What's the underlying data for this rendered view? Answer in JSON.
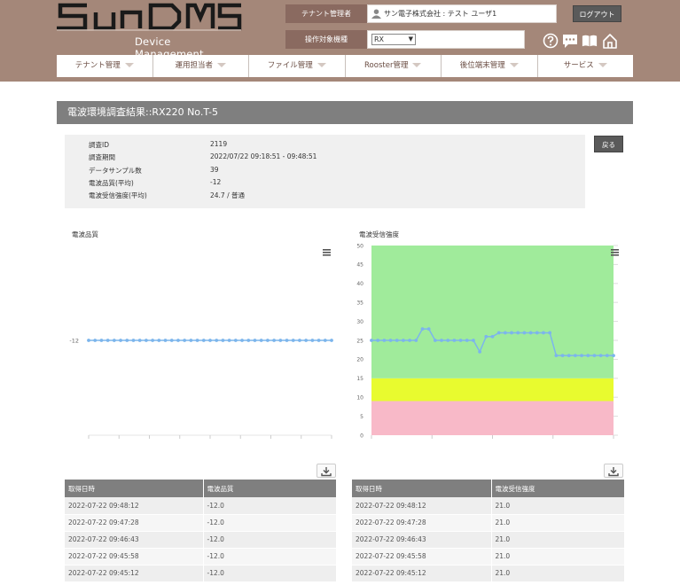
{
  "header": {
    "logo_text": "SunDMS",
    "logo_sub": "Device Management Service",
    "tenant_label": "テナント管理者",
    "tenant_value": "サン電子株式会社 : テスト ユーザ1",
    "model_label": "操作対象機種",
    "model_value": "RX",
    "logout_label": "ログアウト",
    "icons": [
      "help-icon",
      "chat-icon",
      "manual-icon",
      "home-icon"
    ]
  },
  "nav": {
    "items": [
      {
        "label": "テナント管理"
      },
      {
        "label": "運用担当者"
      },
      {
        "label": "ファイル管理"
      },
      {
        "label": "Rooster管理"
      },
      {
        "label": "後位端末管理"
      },
      {
        "label": "サービス"
      }
    ]
  },
  "page": {
    "title": "電波環境調査結果::RX220 No.T-5",
    "back_label": "戻る"
  },
  "info": {
    "rows": [
      {
        "key": "調査ID",
        "value": "2119"
      },
      {
        "key": "調査期間",
        "value": "2022/07/22 09:18:51 - 09:48:51"
      },
      {
        "key": "データサンプル数",
        "value": "39"
      },
      {
        "key": "電波品質(平均)",
        "value": "-12"
      },
      {
        "key": "電波受信強度(平均)",
        "value": "24.7 / 普通"
      }
    ]
  },
  "chart_data": [
    {
      "type": "line",
      "title": "電波品質",
      "y_ticks": [
        "-12"
      ],
      "series": [
        {
          "values": [
            -12,
            -12,
            -12,
            -12,
            -12,
            -12,
            -12,
            -12,
            -12,
            -12,
            -12,
            -12,
            -12,
            -12,
            -12,
            -12,
            -12,
            -12,
            -12,
            -12,
            -12,
            -12,
            -12,
            -12,
            -12,
            -12,
            -12,
            -12,
            -12,
            -12,
            -12,
            -12,
            -12,
            -12,
            -12,
            -12,
            -12,
            -12,
            -12
          ]
        }
      ],
      "line_color": "#7cb5ec"
    },
    {
      "type": "line",
      "title": "電波受信強度",
      "ylim": [
        0,
        50
      ],
      "y_ticks": [
        "0",
        "5",
        "10",
        "15",
        "20",
        "25",
        "30",
        "35",
        "40",
        "45",
        "50"
      ],
      "bands": [
        {
          "from": 0,
          "to": 9,
          "color": "#f8b9c8"
        },
        {
          "from": 9,
          "to": 15,
          "color": "#e8fb2f"
        },
        {
          "from": 15,
          "to": 50,
          "color": "#a0eb9b"
        }
      ],
      "series": [
        {
          "values": [
            25,
            25,
            25,
            25,
            25,
            25,
            25,
            25,
            28,
            28,
            25,
            25,
            25,
            25,
            25,
            25,
            25,
            22,
            26,
            26,
            27,
            27,
            27,
            27,
            27,
            27,
            27,
            27,
            27,
            21,
            21,
            21,
            21,
            21,
            21,
            21,
            21,
            21,
            21
          ]
        }
      ],
      "line_color": "#7cb5ec"
    }
  ],
  "tables": {
    "quality": {
      "headers": [
        "取得日時",
        "電波品質"
      ],
      "rows": [
        [
          "2022-07-22 09:48:12",
          "-12.0"
        ],
        [
          "2022-07-22 09:47:28",
          "-12.0"
        ],
        [
          "2022-07-22 09:46:43",
          "-12.0"
        ],
        [
          "2022-07-22 09:45:58",
          "-12.0"
        ],
        [
          "2022-07-22 09:45:12",
          "-12.0"
        ]
      ]
    },
    "strength": {
      "headers": [
        "取得日時",
        "電波受信強度"
      ],
      "rows": [
        [
          "2022-07-22 09:48:12",
          "21.0"
        ],
        [
          "2022-07-22 09:47:28",
          "21.0"
        ],
        [
          "2022-07-22 09:46:43",
          "21.0"
        ],
        [
          "2022-07-22 09:45:58",
          "21.0"
        ],
        [
          "2022-07-22 09:45:12",
          "21.0"
        ]
      ]
    }
  }
}
